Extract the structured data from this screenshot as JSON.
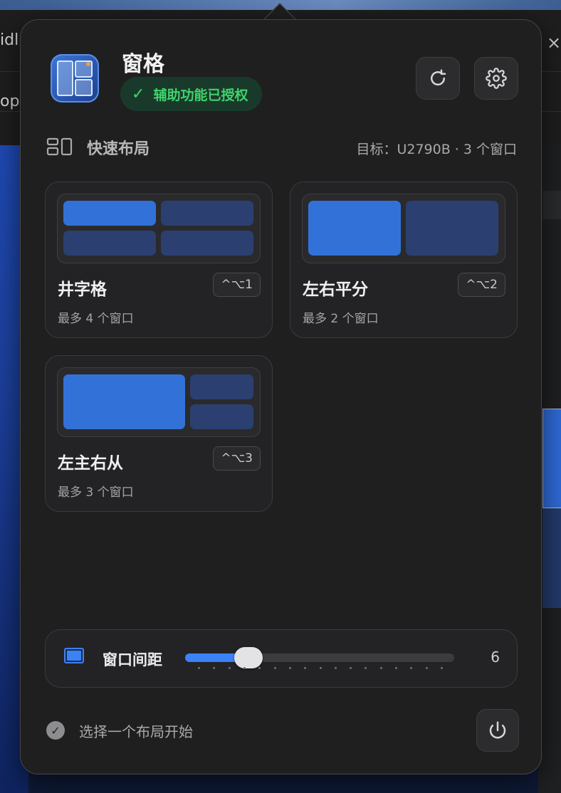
{
  "background": {
    "text_top": "idl",
    "text_mid": "opS",
    "close_glyph": "×"
  },
  "header": {
    "app_title": "窗格",
    "auth_status": "辅助功能已授权",
    "auth_check_icon": "✓",
    "refresh_icon": "refresh-icon",
    "settings_icon": "gear-icon"
  },
  "quick_layout": {
    "title": "快速布局",
    "target": "目标：U2790B · 3 个窗口",
    "cards": [
      {
        "name": "井字格",
        "shortcut": "^⌥1",
        "subtitle": "最多 4 个窗口"
      },
      {
        "name": "左右平分",
        "shortcut": "^⌥2",
        "subtitle": "最多 2 个窗口"
      },
      {
        "name": "左主右从",
        "shortcut": "^⌥3",
        "subtitle": "最多 3 个窗口"
      }
    ]
  },
  "window_gap": {
    "label": "窗口间距",
    "value": "6",
    "slider_fraction": 0.22
  },
  "footer": {
    "hint_icon": "✓",
    "hint": "选择一个布局开始",
    "power_icon": "power-icon"
  },
  "colors": {
    "accent": "#3b82f6",
    "success": "#3fd26b",
    "block_active": "#3272d8",
    "block_inactive": "#2b4070"
  }
}
